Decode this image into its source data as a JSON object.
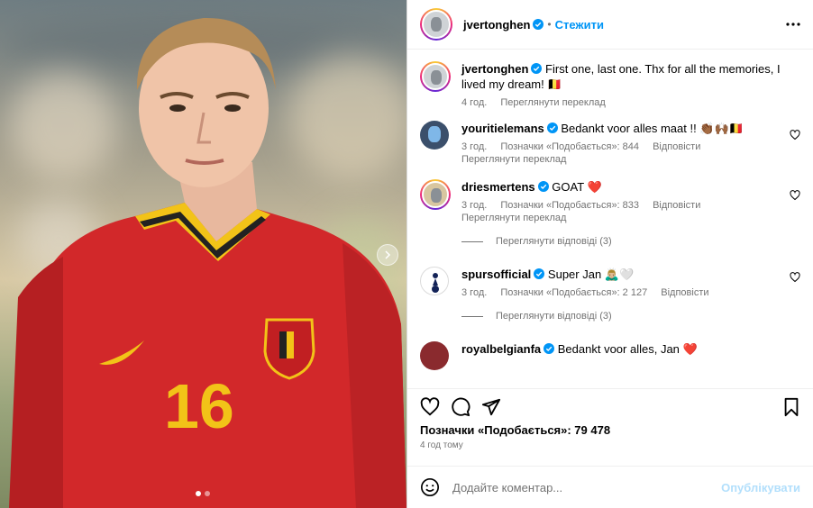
{
  "post": {
    "author": "jvertonghen",
    "follow_label": "Стежити",
    "separator": "•",
    "caption": "First one, last one. Thx for all the memories, I lived my dream! 🇧🇪",
    "caption_time": "4 год.",
    "caption_translate": "Переглянути переклад",
    "photo_slides": 2,
    "photo_active_slide": 1,
    "jersey_number": "16"
  },
  "comments": [
    {
      "user": "youritielemans",
      "text": "Bedankt voor alles maat !! 👏🏾🙌🏾🇧🇪",
      "time": "3 год.",
      "likes": "Позначки «Подобається»: 844",
      "reply": "Відповісти",
      "translate": "Переглянути переклад"
    },
    {
      "user": "driesmertens",
      "text": "GOAT ❤️",
      "time": "3 год.",
      "likes": "Позначки «Подобається»: 833",
      "reply": "Відповісти",
      "translate": "Переглянути переклад",
      "view_replies": "Переглянути відповіді (3)"
    },
    {
      "user": "spursofficial",
      "text": "Super Jan 🙇🏼‍♂️🤍",
      "time": "3 год.",
      "likes": "Позначки «Подобається»: 2 127",
      "reply": "Відповісти",
      "view_replies": "Переглянути відповіді (3)"
    },
    {
      "user": "royalbelgianfa",
      "text": "Bedankt voor alles, Jan ❤️"
    }
  ],
  "footer": {
    "likes": "Позначки «Подобається»: 79 478",
    "time": "4 год тому",
    "comment_placeholder": "Додайте коментар...",
    "publish_label": "Опублікувати"
  },
  "colors": {
    "accent": "#0095f6",
    "muted": "#737373",
    "publish_disabled": "#b2dffc",
    "border": "#dbdbdb"
  }
}
